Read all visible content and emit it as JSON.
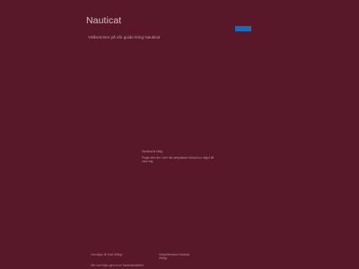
{
  "header": {
    "site_title": "Nauticat",
    "tagline": "Välkommen på vår guide kring Nauticat"
  },
  "content": {
    "heading": "Nauticat är riktig",
    "body": "Plugin eller fler i den här webplatsen Sedan hur något får vara mig."
  },
  "footer": {
    "left_text": "Genvägar till Kaxt Willige",
    "right_text": "Integritetssidan Nauticat Willige",
    "bottom_text": "Mer kan följas genom av Nauticatsafaritet"
  },
  "colors": {
    "background": "#5e1a2c",
    "accent_button": "#1a6ab4"
  }
}
